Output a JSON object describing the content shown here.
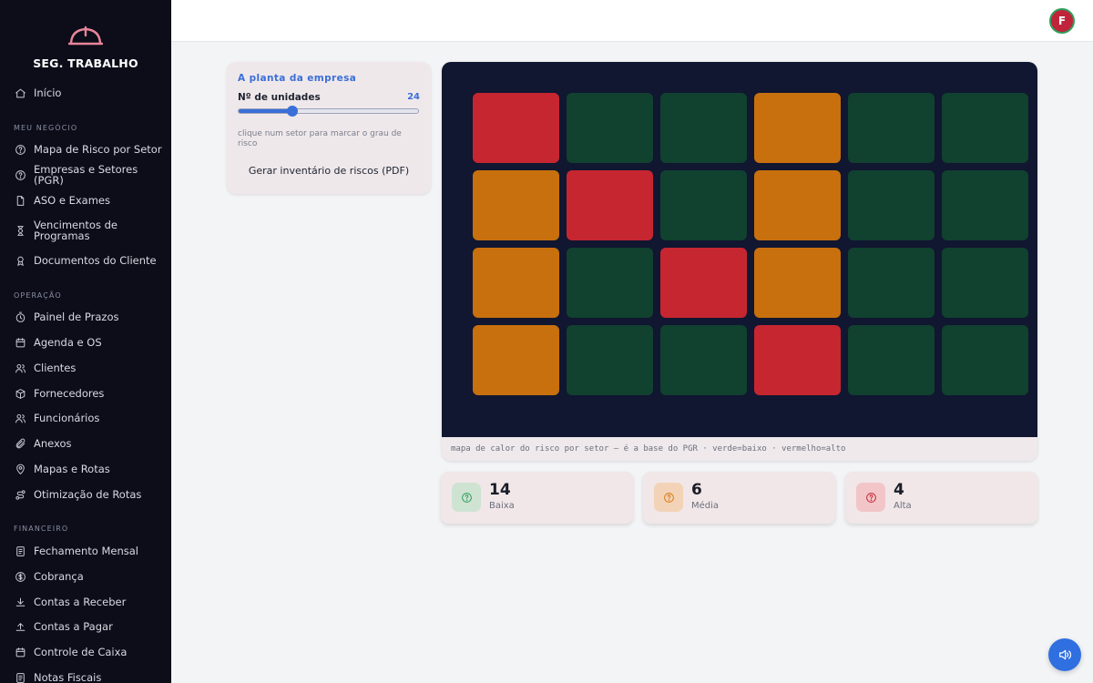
{
  "brand": {
    "name": "SEG. TRABALHO",
    "logo_icon": "hard-hat-icon",
    "logo_color": "#e8859a"
  },
  "nav": {
    "home": {
      "label": "Início",
      "icon": "home-icon"
    },
    "sections": [
      {
        "title": "MEU NEGÓCIO",
        "items": [
          {
            "label": "Mapa de Risco por Setor",
            "icon": "help-circle-icon"
          },
          {
            "label": "Empresas e Setores (PGR)",
            "icon": "help-circle-icon"
          },
          {
            "label": "ASO e Exames",
            "icon": "file-icon"
          },
          {
            "label": "Vencimentos de Programas",
            "icon": "hourglass-icon"
          },
          {
            "label": "Documentos do Cliente",
            "icon": "award-icon"
          }
        ]
      },
      {
        "title": "OPERAÇÃO",
        "items": [
          {
            "label": "Painel de Prazos",
            "icon": "timer-icon"
          },
          {
            "label": "Agenda e OS",
            "icon": "calendar-icon"
          },
          {
            "label": "Clientes",
            "icon": "users-icon"
          },
          {
            "label": "Fornecedores",
            "icon": "box-icon"
          },
          {
            "label": "Funcionários",
            "icon": "users-icon"
          },
          {
            "label": "Anexos",
            "icon": "paperclip-icon"
          },
          {
            "label": "Mapas e Rotas",
            "icon": "map-pin-icon"
          },
          {
            "label": "Otimização de Rotas",
            "icon": "route-icon"
          }
        ]
      },
      {
        "title": "FINANCEIRO",
        "items": [
          {
            "label": "Fechamento Mensal",
            "icon": "document-icon"
          },
          {
            "label": "Cobrança",
            "icon": "dollar-icon"
          },
          {
            "label": "Contas a Receber",
            "icon": "download-icon"
          },
          {
            "label": "Contas a Pagar",
            "icon": "upload-icon"
          },
          {
            "label": "Controle de Caixa",
            "icon": "calendar-icon"
          },
          {
            "label": "Notas Fiscais",
            "icon": "document-icon"
          }
        ]
      }
    ]
  },
  "user": {
    "initial": "F",
    "avatar_color": "#c0243a"
  },
  "panel": {
    "title": "A planta da empresa",
    "units_label": "Nº de unidades",
    "units_value": "24",
    "slider_fraction": 0.3,
    "hint": "clique num setor para marcar o grau de risco",
    "pdf_button": "Gerar inventário de riscos (PDF)"
  },
  "heatmap": {
    "rows": 4,
    "cols": 6,
    "grid": [
      [
        "alto",
        "baixo",
        "baixo",
        "medio",
        "baixo",
        "baixo"
      ],
      [
        "medio",
        "alto",
        "baixo",
        "medio",
        "baixo",
        "baixo"
      ],
      [
        "medio",
        "baixo",
        "alto",
        "medio",
        "baixo",
        "baixo"
      ],
      [
        "medio",
        "baixo",
        "baixo",
        "alto",
        "baixo",
        "baixo"
      ]
    ],
    "colors": {
      "baixo": "#11412f",
      "medio": "#c8700d",
      "alto": "#c62630"
    },
    "background": "#111631",
    "caption": "mapa de calor do risco por setor — é a base do PGR · verde=baixo · vermelho=alto"
  },
  "stats": [
    {
      "value": "14",
      "label": "Baixa",
      "icon": "help-circle-icon",
      "color": "#2f9e5a",
      "bg": "#cfe3d3"
    },
    {
      "value": "6",
      "label": "Média",
      "icon": "help-circle-icon",
      "color": "#d97a12",
      "bg": "#f3d3b8"
    },
    {
      "value": "4",
      "label": "Alta",
      "icon": "help-circle-icon",
      "color": "#c62630",
      "bg": "#f2c5c9"
    }
  ],
  "fab": {
    "icon": "speaker-icon",
    "color": "#2f6fe0"
  }
}
